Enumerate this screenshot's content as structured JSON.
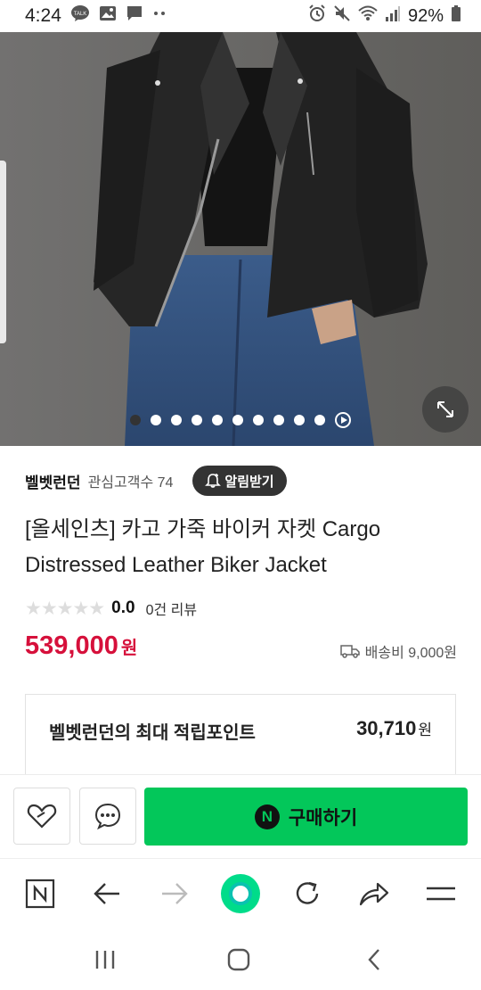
{
  "status_bar": {
    "time": "4:24",
    "battery": "92%",
    "left_icons": [
      "talk-icon",
      "gallery-icon",
      "message-icon",
      "more-dots-icon"
    ],
    "right_icons": [
      "alarm-icon",
      "mute-icon",
      "wifi-icon",
      "signal-icon",
      "battery-icon"
    ]
  },
  "hero": {
    "image_alt": "product-photo",
    "dots_count": 10,
    "active_dot": 0
  },
  "seller": {
    "name": "벨벳런던",
    "fans_label": "관심고객수 74",
    "alarm_button": "알림받기"
  },
  "product": {
    "title": "[올세인츠] 카고 가죽 바이커 자켓 Cargo Distressed Leather Biker Jacket",
    "rating": "0.0",
    "reviews": "0건 리뷰",
    "price": "539,000",
    "price_unit": "원",
    "shipping": "배송비 9,000원"
  },
  "points": {
    "label": "벨벳런던의 최대 적립포인트",
    "value": "30,710",
    "unit": "원"
  },
  "actions": {
    "buy_label": "구매하기",
    "n_badge": "N"
  },
  "colors": {
    "price": "#d6103b",
    "buy_button": "#03c75a",
    "browser_home": "#00dc8a"
  }
}
